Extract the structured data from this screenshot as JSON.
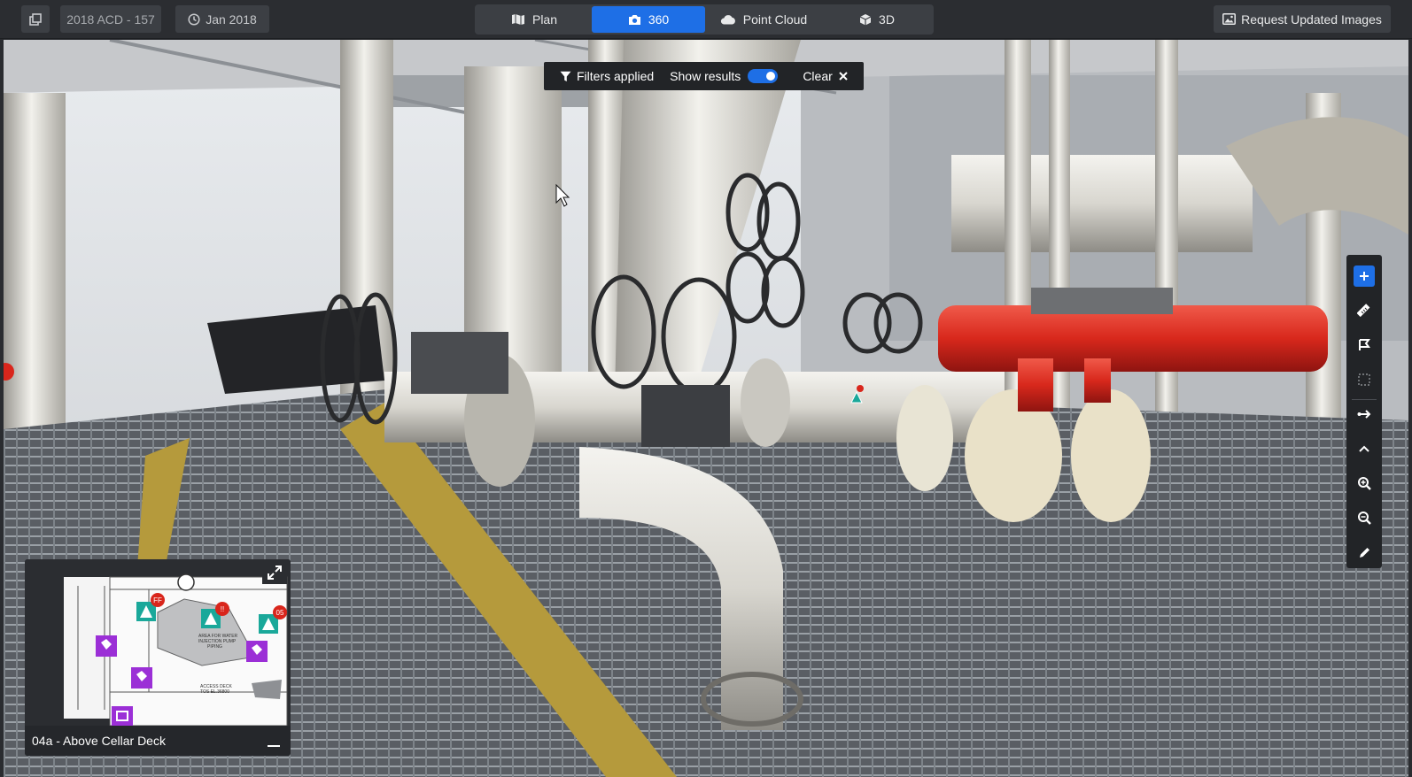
{
  "toolbar": {
    "dataset_label": "2018 ACD - 157",
    "date_label": "Jan 2018",
    "request_button_label": "Request Updated Images",
    "icons": {
      "layers": "layers-icon",
      "clock": "clock-icon",
      "image": "image-icon"
    }
  },
  "view_tabs": [
    {
      "label": "Plan",
      "icon": "map-icon",
      "active": false
    },
    {
      "label": "360",
      "icon": "camera-icon",
      "active": true
    },
    {
      "label": "Point Cloud",
      "icon": "cloud-icon",
      "active": false
    },
    {
      "label": "3D",
      "icon": "cube-icon",
      "active": false
    }
  ],
  "filter_bar": {
    "filters_label": "Filters applied",
    "show_results_label": "Show results",
    "show_results_on": true,
    "clear_label": "Clear"
  },
  "tools": [
    {
      "name": "add-icon"
    },
    {
      "name": "ruler-icon"
    },
    {
      "name": "flag-icon"
    },
    {
      "name": "selection-icon"
    },
    {
      "name": "arrow-right-icon"
    },
    {
      "name": "chevron-up-icon"
    },
    {
      "name": "zoom-in-icon"
    },
    {
      "name": "zoom-out-icon"
    },
    {
      "name": "pencil-icon"
    }
  ],
  "minimap": {
    "location_label": "04a - Above Cellar Deck",
    "markers": [
      "FF",
      "!!",
      "05"
    ],
    "plan_text": [
      "AREA FOR WATER",
      "INJECTION PUMP",
      "PIPING",
      "ACCESS DECK",
      "TOS EL.36800"
    ]
  },
  "colors": {
    "accent": "#1e6fe6",
    "toolbar_bg": "#2b2d31",
    "warning_marker": "#1aa89a",
    "tag_marker": "#9b2fd6",
    "issue_marker": "#d9261c"
  }
}
